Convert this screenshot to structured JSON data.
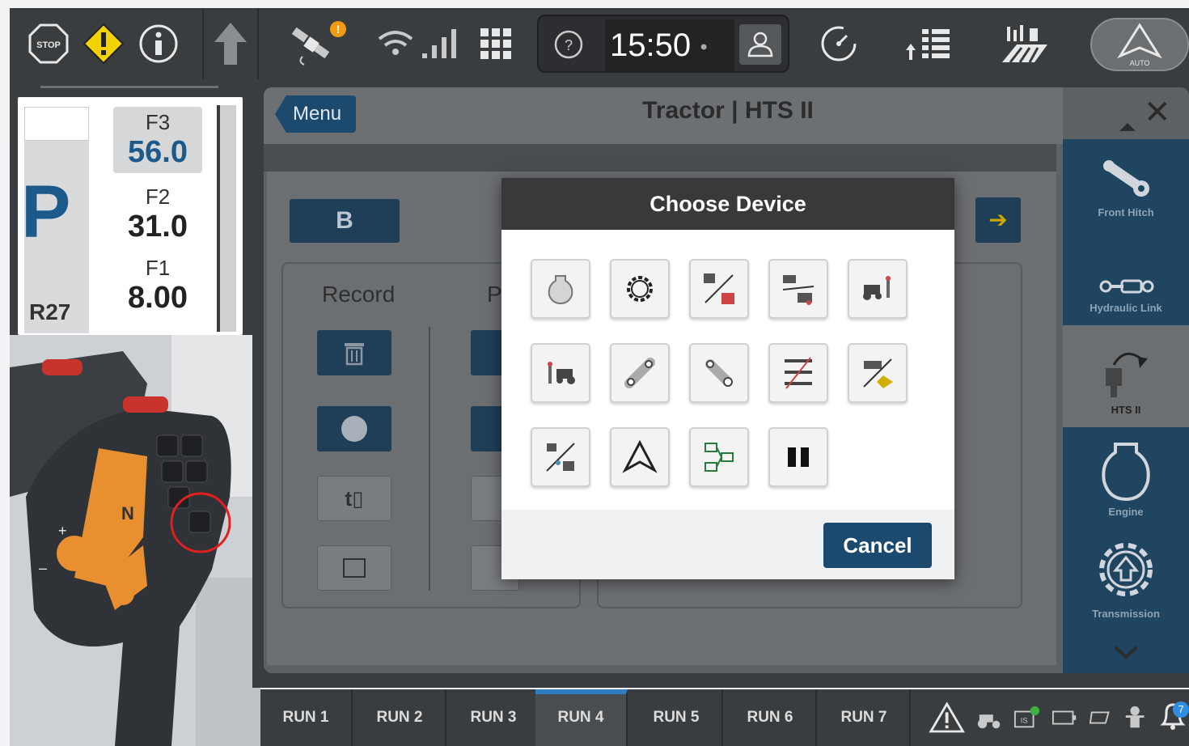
{
  "topbar": {
    "stop_icon": "stop-icon",
    "warning_icon": "warning-icon",
    "info_icon": "info-icon",
    "up_arrow_icon": "up-arrow-icon",
    "satellite_icon": "satellite-icon",
    "wifi_icon": "wifi-icon",
    "signal_icon": "signal-icon",
    "grid_icon": "grid-icon",
    "help_icon": "help-icon",
    "time": "15:50",
    "user_icon": "user-icon",
    "gauge_icon": "gauge-icon",
    "list_icon": "list-icon",
    "field_icon": "field-icon",
    "auto_label": "AUTO"
  },
  "gear": {
    "mode": "P",
    "range": "R27",
    "f3_label": "F3",
    "f3_value": "56.0",
    "f2_label": "F2",
    "f2_value": "31.0",
    "f1_label": "F1",
    "f1_value": "8.00"
  },
  "screen": {
    "menu_label": "Menu",
    "title": "Tractor | HTS II",
    "b_label": "B",
    "record_label": "Record",
    "p_label": "P"
  },
  "sidebar": {
    "items": [
      {
        "label": "Front Hitch",
        "icon": "front-hitch-icon"
      },
      {
        "label": "Hydraulic Link",
        "icon": "hydraulic-link-icon"
      },
      {
        "label": "HTS II",
        "icon": "hts-icon"
      },
      {
        "label": "Engine",
        "icon": "engine-icon"
      },
      {
        "label": "Transmission",
        "icon": "transmission-icon"
      }
    ]
  },
  "modal": {
    "title": "Choose Device",
    "cancel_label": "Cancel",
    "devices": [
      "engine-device-icon",
      "gear-device-icon",
      "ratio-device-icon",
      "tractor-ratio-device-icon",
      "tractor-hitch-device-icon",
      "hitch-tractor-device-icon",
      "link-device-icon",
      "hitch-device-icon",
      "axle-device-icon",
      "implement-device-icon",
      "pto-ratio-device-icon",
      "autoguide-device-icon",
      "network-device-icon",
      "pause-device-icon"
    ]
  },
  "bottombar": {
    "runs": [
      "RUN 1",
      "RUN 2",
      "RUN 3",
      "RUN 4",
      "RUN 5",
      "RUN 6",
      "RUN 7"
    ],
    "active_run": 3,
    "status_icons": [
      "alert-icon",
      "tractor-status-icon",
      "isobus-icon",
      "battery-icon",
      "implement-icon",
      "worker-icon",
      "notification-icon"
    ],
    "notification_count": "7"
  },
  "colors": {
    "accent_blue": "#1b4a6e",
    "active_tab": "#2f7cc0",
    "warning_yellow": "#f2d200",
    "highlight_red": "#e02020"
  }
}
